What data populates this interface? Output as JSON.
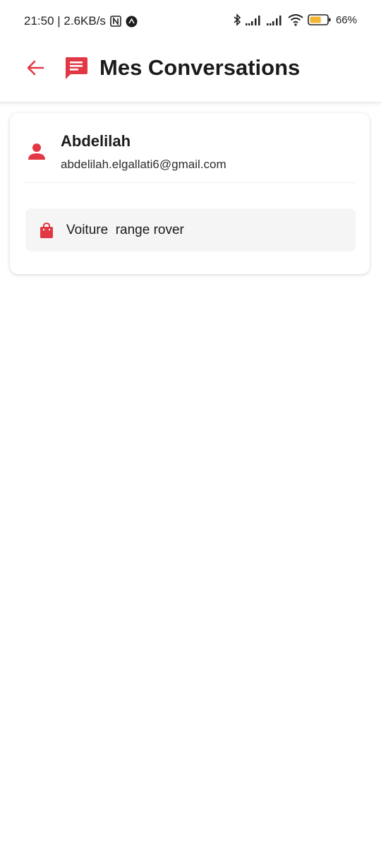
{
  "status_bar": {
    "time_speed": "21:50 | 2.6KB/s",
    "battery_percent": "66%",
    "battery_level": 0.66,
    "icons": [
      "nfc-icon",
      "app-notification-icon",
      "bluetooth-icon",
      "signal-1-icon",
      "signal-2-icon",
      "wifi-icon",
      "battery-icon"
    ]
  },
  "header": {
    "title": "Mes Conversations",
    "back_icon": "arrow-left-icon",
    "title_icon": "chat-icon"
  },
  "conversations": [
    {
      "name": "Abdelilah",
      "email": "abdelilah.elgallati6@gmail.com",
      "product": "Voiture  range rover",
      "user_icon": "person-icon",
      "product_icon": "shopping-bag-icon"
    }
  ],
  "colors": {
    "accent": "#e23744",
    "background": "#ffffff",
    "product_row_bg": "#f5f5f5",
    "battery_fill": "#f2b632"
  }
}
